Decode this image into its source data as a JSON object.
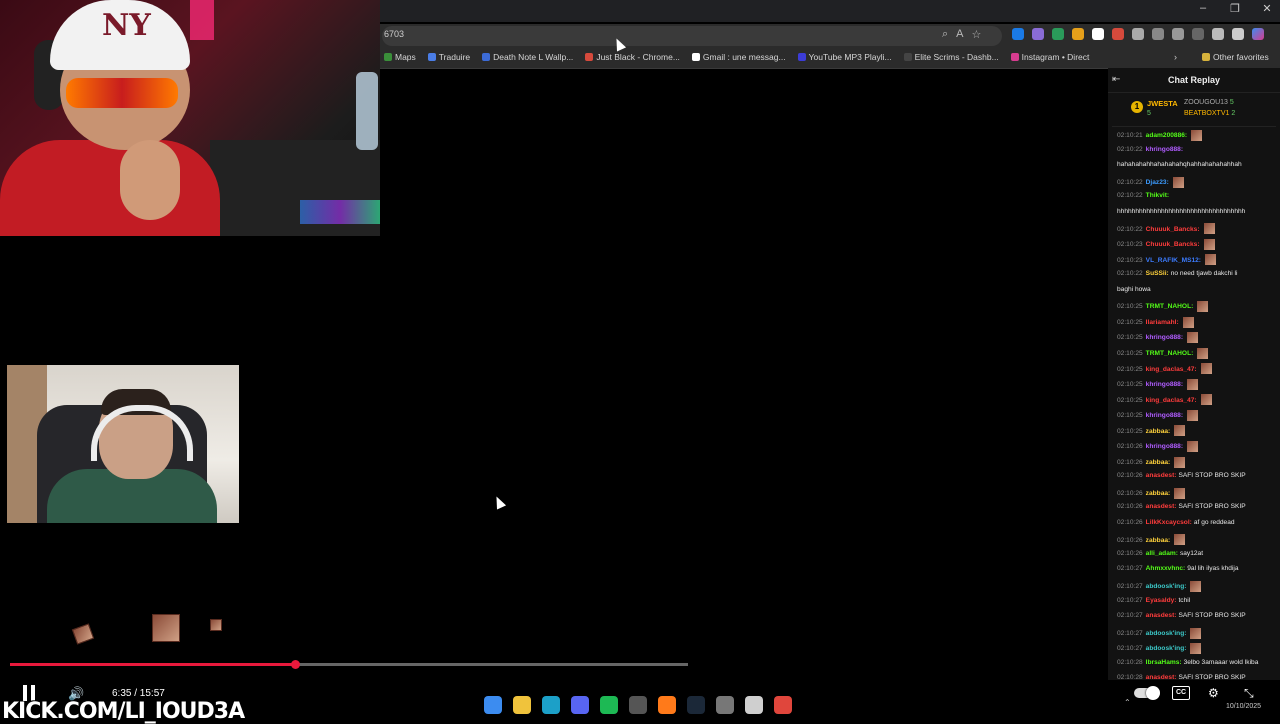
{
  "browser": {
    "url_fragment": "6703",
    "window_controls": [
      "–",
      "❐",
      "✕"
    ],
    "bookmarks": [
      {
        "label": "Maps",
        "color": "#3a8f3a"
      },
      {
        "label": "Traduire",
        "color": "#4a7de6"
      },
      {
        "label": "Death Note L Wallp...",
        "color": "#3c6bd6"
      },
      {
        "label": "Just Black - Chrome...",
        "color": "#d64a3c"
      },
      {
        "label": "Gmail : une messag...",
        "color": "#ffffff"
      },
      {
        "label": "YouTube MP3 Playli...",
        "color": "#3c3cd6"
      },
      {
        "label": "Elite Scrims - Dashb...",
        "color": "#444444"
      },
      {
        "label": "Instagram • Direct",
        "color": "#d63c8f"
      }
    ],
    "other_favorites": "Other favorites"
  },
  "chat": {
    "title": "Chat Replay",
    "leaderboard": {
      "rank": "1",
      "first": "JWESTA",
      "first_sub": "5",
      "second": "ZOOUGOU13",
      "second_sub": "5",
      "third": "BEATBOXTV1",
      "third_sub": "2"
    },
    "messages": [
      {
        "ts": "02:10:21",
        "user": "adam200886",
        "color": "#53fc18",
        "text": "",
        "emote": true
      },
      {
        "ts": "02:10:22",
        "user": "khringo888",
        "color": "#b05cff",
        "text": "",
        "emote": false
      },
      {
        "ts": "",
        "user": "",
        "color": "#ffffff",
        "text": "hahahahahhahahahahqhahhahahahahhah",
        "emote": false
      },
      {
        "ts": "02:10:22",
        "user": "Djaz23",
        "color": "#3c9cff",
        "text": "",
        "emote": true
      },
      {
        "ts": "02:10:22",
        "user": "Thikvit",
        "color": "#53fc18",
        "text": "",
        "emote": false
      },
      {
        "ts": "",
        "user": "",
        "color": "#ffffff",
        "text": "hhhhhhhhhhhhhhhhhhhhhhhhhhhhhhhhhhh",
        "emote": false
      },
      {
        "ts": "02:10:22",
        "user": "Chuuuk_Bancks",
        "color": "#ff3c3c",
        "text": "",
        "emote": true
      },
      {
        "ts": "02:10:23",
        "user": "Chuuuk_Bancks",
        "color": "#ff3c3c",
        "text": "",
        "emote": true
      },
      {
        "ts": "02:10:23",
        "user": "VL_RAFIK_MS12",
        "color": "#3c7cff",
        "text": "",
        "emote": true
      },
      {
        "ts": "02:10:22",
        "user": "SuSSii",
        "color": "#ffd23c",
        "text": "no need tjawb dakchi li",
        "emote": false
      },
      {
        "ts": "",
        "user": "",
        "color": "#ffffff",
        "text": "baghi howa",
        "emote": false
      },
      {
        "ts": "02:10:25",
        "user": "TRMT_NAHOL",
        "color": "#53fc18",
        "text": "",
        "emote": true
      },
      {
        "ts": "02:10:25",
        "user": "Ilariamahl",
        "color": "#ff3c3c",
        "text": "",
        "emote": true
      },
      {
        "ts": "02:10:25",
        "user": "khringo888",
        "color": "#b05cff",
        "text": "",
        "emote": true
      },
      {
        "ts": "02:10:25",
        "user": "TRMT_NAHOL",
        "color": "#53fc18",
        "text": "",
        "emote": true
      },
      {
        "ts": "02:10:25",
        "user": "king_daclas_47",
        "color": "#ff3c3c",
        "text": "",
        "emote": true
      },
      {
        "ts": "02:10:25",
        "user": "khringo888",
        "color": "#b05cff",
        "text": "",
        "emote": true
      },
      {
        "ts": "02:10:25",
        "user": "king_daclas_47",
        "color": "#ff3c3c",
        "text": "",
        "emote": true
      },
      {
        "ts": "02:10:25",
        "user": "khringo888",
        "color": "#b05cff",
        "text": "",
        "emote": true
      },
      {
        "ts": "02:10:25",
        "user": "zabbaa",
        "color": "#ffd23c",
        "text": "",
        "emote": true
      },
      {
        "ts": "02:10:26",
        "user": "khringo888",
        "color": "#b05cff",
        "text": "",
        "emote": true
      },
      {
        "ts": "02:10:26",
        "user": "zabbaa",
        "color": "#ffd23c",
        "text": "",
        "emote": true
      },
      {
        "ts": "02:10:26",
        "user": "anasdest",
        "color": "#ff3c3c",
        "text": "SAFI STOP BRO SKIP",
        "emote": false
      },
      {
        "ts": "02:10:26",
        "user": "zabbaa",
        "color": "#ffd23c",
        "text": "",
        "emote": true
      },
      {
        "ts": "02:10:26",
        "user": "anasdest",
        "color": "#ff3c3c",
        "text": "SAFI STOP BRO SKIP",
        "emote": false
      },
      {
        "ts": "02:10:26",
        "user": "LilkKxcaycsol",
        "color": "#ff3c3c",
        "text": "af go reddead",
        "emote": false
      },
      {
        "ts": "02:10:26",
        "user": "zabbaa",
        "color": "#ffd23c",
        "text": "",
        "emote": true
      },
      {
        "ts": "02:10:26",
        "user": "alli_adam",
        "color": "#53fc18",
        "text": "say12at",
        "emote": false
      },
      {
        "ts": "02:10:27",
        "user": "Ahmxxvhnc",
        "color": "#53fc18",
        "text": "9al lih ilyas khdija",
        "emote": false
      },
      {
        "ts": "02:10:27",
        "user": "abdoosk'ing",
        "color": "#3cc9c9",
        "text": "",
        "emote": true
      },
      {
        "ts": "02:10:27",
        "user": "Eyasaldy",
        "color": "#ff3c3c",
        "text": "tchil",
        "emote": false
      },
      {
        "ts": "02:10:27",
        "user": "anasdest",
        "color": "#ff3c3c",
        "text": "SAFI STOP BRO SKIP",
        "emote": false
      },
      {
        "ts": "02:10:27",
        "user": "abdoosk'ing",
        "color": "#3cc9c9",
        "text": "",
        "emote": true
      },
      {
        "ts": "02:10:27",
        "user": "abdoosk'ing",
        "color": "#3cc9c9",
        "text": "",
        "emote": true
      },
      {
        "ts": "02:10:28",
        "user": "IbrsaHams",
        "color": "#53fc18",
        "text": "3elbo 3amaaar wold lkiba",
        "emote": false
      },
      {
        "ts": "02:10:28",
        "user": "anasdest",
        "color": "#ff3c3c",
        "text": "SAFI STOP BRO SKIP",
        "emote": false
      }
    ]
  },
  "player": {
    "current_time": "6:35",
    "duration": "15:57",
    "time_display": "6:35 / 15:57",
    "progress": 0.4198,
    "buffered": 0.6287,
    "accent": "#e8193c"
  },
  "overlay": {
    "channel_text": "KICK.COM/LI_IOUD3A"
  },
  "taskbar": {
    "icons": [
      {
        "name": "windows-start-icon",
        "color": "#3c8cf0"
      },
      {
        "name": "file-explorer-icon",
        "color": "#f0c33c"
      },
      {
        "name": "edge-browser-icon",
        "color": "#1ca0c8"
      },
      {
        "name": "discord-icon",
        "color": "#5865f2"
      },
      {
        "name": "spotify-icon",
        "color": "#1db954"
      },
      {
        "name": "store-icon",
        "color": "#555555"
      },
      {
        "name": "app-orange-icon",
        "color": "#ff7a1a"
      },
      {
        "name": "steam-icon",
        "color": "#1b2838"
      },
      {
        "name": "settings-app-icon",
        "color": "#777777"
      },
      {
        "name": "game-launcher-icon",
        "color": "#cfcfcf"
      },
      {
        "name": "chrome-icon",
        "color": "#e0463c"
      }
    ],
    "date": "10/10/2025"
  }
}
